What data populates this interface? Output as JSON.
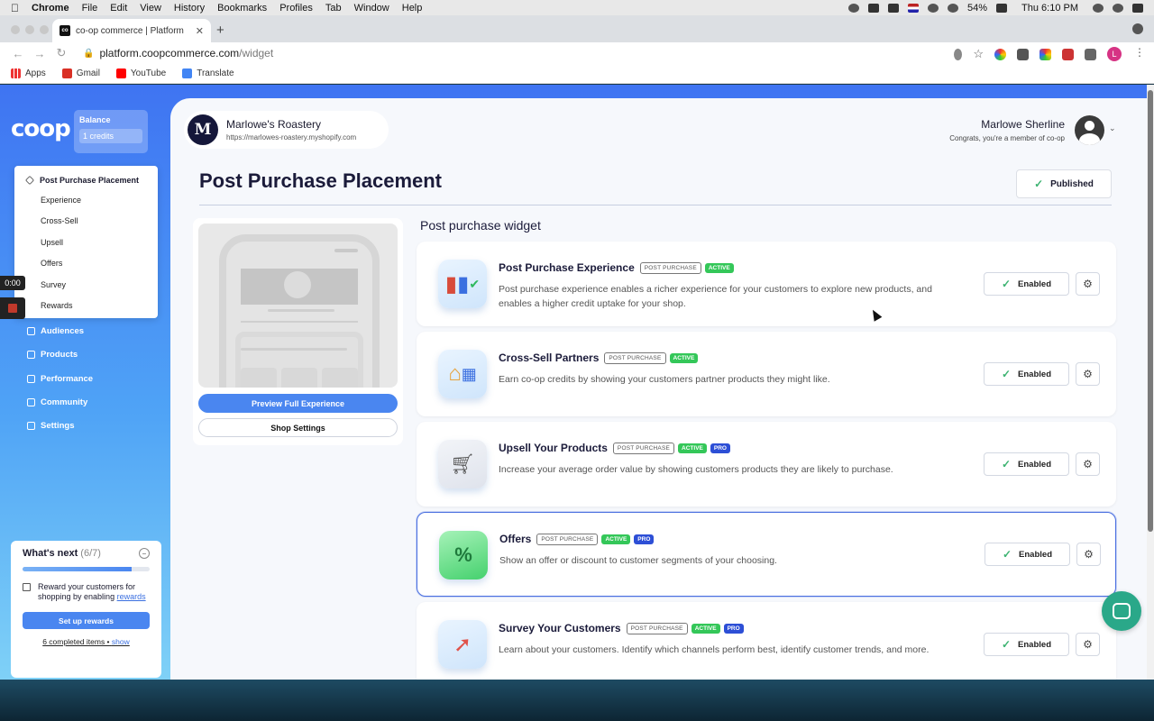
{
  "menubar": {
    "app": "Chrome",
    "items": [
      "File",
      "Edit",
      "View",
      "History",
      "Bookmarks",
      "Profiles",
      "Tab",
      "Window",
      "Help"
    ],
    "battery": "54%",
    "clock": "Thu 6:10 PM"
  },
  "browser": {
    "tab_title": "co-op commerce | Platform",
    "tab_favicon": "co",
    "url_host": "platform.coopcommerce.com",
    "url_path": "/widget",
    "profile_initial": "L",
    "bookmarks": [
      "Apps",
      "Gmail",
      "YouTube",
      "Translate"
    ]
  },
  "sidebar": {
    "logo": "coop",
    "balance_label": "Balance",
    "balance_value": "1 credits",
    "menu_header": "Post Purchase Placement",
    "menu_items": [
      "Experience",
      "Cross-Sell",
      "Upsell",
      "Offers",
      "Survey",
      "Rewards"
    ],
    "links": [
      "Audiences",
      "Products",
      "Performance",
      "Community",
      "Settings"
    ],
    "recorder_time": "0:00"
  },
  "whats_next": {
    "title": "What's next",
    "count": "(6/7)",
    "progress": 0.857,
    "item_text": "Reward your customers for shopping by enabling",
    "item_link": "rewards",
    "button": "Set up rewards",
    "footer": "6 completed items •",
    "footer_link": "show"
  },
  "header": {
    "shop_initial": "M",
    "shop_name": "Marlowe's Roastery",
    "shop_url": "https://marlowes-roastery.myshopify.com",
    "user_name": "Marlowe Sherline",
    "user_sub": "Congrats, you're a member of co-op"
  },
  "page": {
    "title": "Post Purchase Placement",
    "published": "Published",
    "section_title": "Post purchase widget",
    "preview_button": "Preview Full Experience",
    "shop_settings_button": "Shop Settings"
  },
  "widgets": [
    {
      "title": "Post Purchase Experience",
      "tag": "POST PURCHASE",
      "status": "ACTIVE",
      "pro": "",
      "description": "Post purchase experience enables a richer experience for your customers to explore new products, and enables a higher credit uptake for your shop.",
      "button": "Enabled",
      "icon": "shopping-bags-icon"
    },
    {
      "title": "Cross-Sell Partners",
      "tag": "POST PURCHASE",
      "status": "ACTIVE",
      "pro": "",
      "description": "Earn co-op credits by showing your customers partner products they might like.",
      "button": "Enabled",
      "icon": "storefront-icon"
    },
    {
      "title": "Upsell Your Products",
      "tag": "POST PURCHASE",
      "status": "ACTIVE",
      "pro": "PRO",
      "description": "Increase your average order value by showing customers products they are likely to purchase.",
      "button": "Enabled",
      "icon": "shopping-cart-icon"
    },
    {
      "title": "Offers",
      "tag": "POST PURCHASE",
      "status": "ACTIVE",
      "pro": "PRO",
      "description": "Show an offer or discount to customer segments of your choosing.",
      "button": "Enabled",
      "icon": "percent-tag-icon"
    },
    {
      "title": "Survey Your Customers",
      "tag": "POST PURCHASE",
      "status": "ACTIVE",
      "pro": "PRO",
      "description": "Learn about your customers. Identify which channels perform best, identify customer trends, and more.",
      "button": "Enabled",
      "icon": "compass-icon"
    }
  ],
  "colors": {
    "accent": "#4a86f0",
    "active": "#34c759",
    "pro": "#2d4fd6",
    "dark": "#1b1b3a"
  }
}
